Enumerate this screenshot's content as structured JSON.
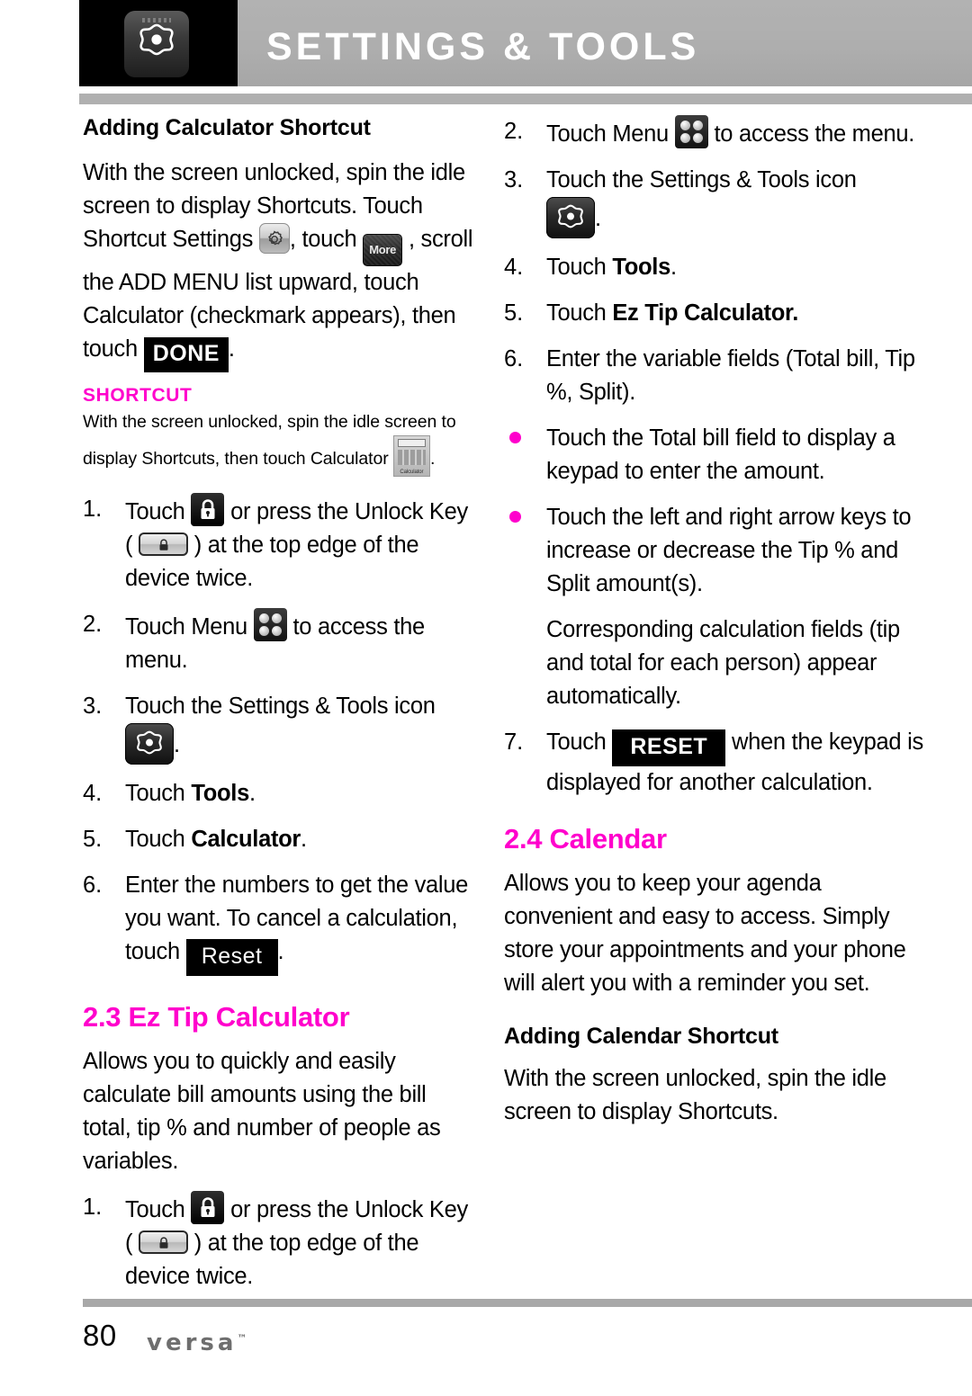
{
  "header": {
    "title": "SETTINGS & TOOLS",
    "icon_name": "settings-tools-phone-icon"
  },
  "left_column": {
    "subheading": "Adding Calculator Shortcut",
    "intro_p1": "With the screen unlocked, spin the idle screen to display Shortcuts. Touch Shortcut Settings",
    "intro_p2": ", touch",
    "intro_p3": ", scroll the ADD MENU list upward, touch Calculator (checkmark appears), then touch",
    "done_label": "DONE",
    "more_label": "More",
    "intro_p4": ".",
    "note": {
      "title": "SHORTCUT",
      "text_a": "With the screen unlocked, spin the idle screen to display Shortcuts, then touch Calculator",
      "text_b": ".",
      "calculator_icon_label": "Calculator"
    },
    "steps": [
      {
        "marker": "1.",
        "text_a": "Touch",
        "text_b": "or press the Unlock Key (",
        "text_c": ") at the top edge of the device twice."
      },
      {
        "marker": "2.",
        "text_a": "Touch Menu",
        "text_b": "to access the menu."
      },
      {
        "marker": "3.",
        "text_a": "Touch the Settings & Tools icon",
        "text_b": "."
      },
      {
        "marker": "4.",
        "text_a": "Touch",
        "bold": "Tools",
        "text_b": "."
      },
      {
        "marker": "5.",
        "text_a": "Touch",
        "bold": "Calculator",
        "text_b": "."
      },
      {
        "marker": "6.",
        "text_a": "Enter the numbers to get the value you want. To cancel a calculation, touch",
        "reset_label": "Reset",
        "text_b": "."
      }
    ],
    "section": {
      "title": "2.3 Ez Tip Calculator",
      "body": "Allows you to quickly and easily calculate bill amounts using the bill total, tip % and number of people as variables.",
      "step1": {
        "marker": "1.",
        "text_a": "Touch",
        "text_b": "or press the Unlock Key (",
        "text_c": ") at the top edge of the device twice."
      }
    }
  },
  "right_column": {
    "steps": [
      {
        "marker": "2.",
        "text_a": "Touch Menu",
        "text_b": "to access the menu."
      },
      {
        "marker": "3.",
        "text_a": "Touch the Settings & Tools icon",
        "text_b": "."
      },
      {
        "marker": "4.",
        "text_a": "Touch",
        "bold": "Tools",
        "text_b": "."
      },
      {
        "marker": "5.",
        "text_a": "Touch",
        "bold": "Ez Tip Calculator.",
        "text_b": ""
      },
      {
        "marker": "6.",
        "text_a": "Enter the variable fields (Total bill, Tip %, Split)."
      }
    ],
    "bullets": [
      "Touch the Total bill field to display a keypad to enter the amount.",
      "Touch the left and right arrow keys to increase or decrease the Tip % and Split amount(s)."
    ],
    "note_paragraph": "Corresponding calculation fields (tip and total for each person) appear automatically.",
    "step7": {
      "marker": "7.",
      "text_a": "Touch",
      "reset_label": "RESET",
      "text_b": "when the keypad is displayed for another calculation."
    },
    "section": {
      "title": "2.4 Calendar",
      "body": "Allows you to keep your agenda convenient and easy to access. Simply store your appointments and your phone will alert you with a reminder you set.",
      "subheading": "Adding Calendar Shortcut",
      "sub_body": "With the screen unlocked, spin the idle screen to display Shortcuts."
    }
  },
  "footer": {
    "page_number": "80",
    "brand": "versa",
    "brand_tm": "™"
  },
  "colors": {
    "accent": "#ff00cc",
    "header_bar": "#b0b0b0",
    "rule": "#a8a8a8"
  }
}
